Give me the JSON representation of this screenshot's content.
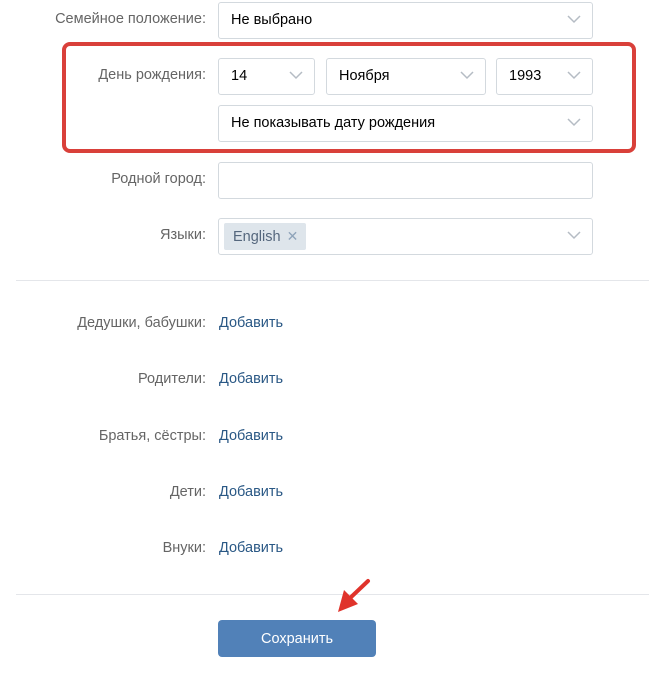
{
  "form": {
    "marital_status": {
      "label": "Семейное положение:",
      "value": "Не выбрано"
    },
    "birthday": {
      "label": "День рождения:",
      "day": "14",
      "month": "Ноября",
      "year": "1993",
      "visibility": "Не показывать дату рождения"
    },
    "hometown": {
      "label": "Родной город:",
      "value": ""
    },
    "languages": {
      "label": "Языки:",
      "tags": [
        "English"
      ],
      "remove_symbol": "✕"
    }
  },
  "relatives": [
    {
      "label": "Дедушки, бабушки:",
      "action": "Добавить"
    },
    {
      "label": "Родители:",
      "action": "Добавить"
    },
    {
      "label": "Братья, сёстры:",
      "action": "Добавить"
    },
    {
      "label": "Дети:",
      "action": "Добавить"
    },
    {
      "label": "Внуки:",
      "action": "Добавить"
    }
  ],
  "save_button": {
    "label": "Сохранить"
  },
  "colors": {
    "accent": "#5181b8",
    "highlight": "#d9403a",
    "link": "#2a5885"
  }
}
